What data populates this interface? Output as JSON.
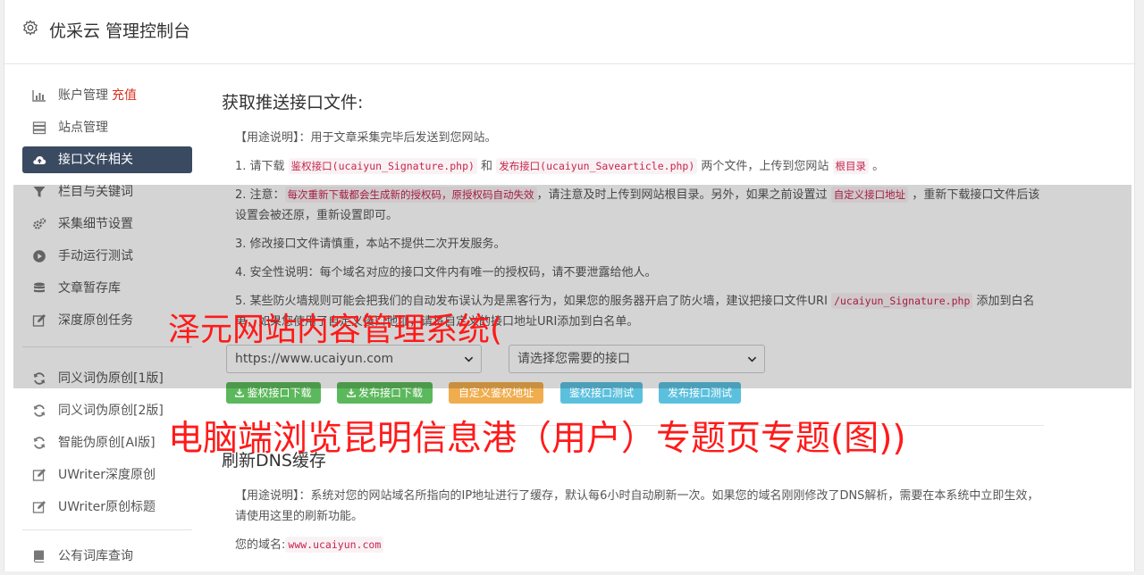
{
  "header": {
    "title": "优采云 管理控制台",
    "icon": "gear-icon"
  },
  "sidebar": {
    "items": [
      {
        "label": "账户管理",
        "extra": "充值",
        "icon": "bar-chart-icon"
      },
      {
        "label": "站点管理",
        "icon": "server-icon"
      },
      {
        "label": "接口文件相关",
        "icon": "cloud-upload-icon",
        "active": true
      },
      {
        "label": "栏目与关键词",
        "icon": "filter-icon"
      },
      {
        "label": "采集细节设置",
        "icon": "cogs-icon"
      },
      {
        "label": "手动运行测试",
        "icon": "play-circle-icon"
      },
      {
        "label": "文章暂存库",
        "icon": "database-icon"
      },
      {
        "label": "深度原创任务",
        "icon": "edit-icon"
      },
      {
        "label": "同义词伪原创[1版]",
        "icon": "refresh-icon"
      },
      {
        "label": "同义词伪原创[2版]",
        "icon": "refresh-icon"
      },
      {
        "label": "智能伪原创[AI版]",
        "icon": "refresh-icon"
      },
      {
        "label": "UWriter深度原创",
        "icon": "edit-icon"
      },
      {
        "label": "UWriter原创标题",
        "icon": "edit-icon"
      },
      {
        "label": "公有词库查询",
        "icon": "book-icon"
      }
    ]
  },
  "main": {
    "section1": {
      "title": "获取推送接口文件:",
      "usage": "【用途说明】：用于文章采集完毕后发送到您网站。",
      "p1": {
        "a": "1. 请下载 ",
        "c1": "鉴权接口(ucaiyun_Signature.php)",
        "b": " 和 ",
        "c2": "发布接口(ucaiyun_Savearticle.php)",
        "d": " 两个文件，上传到您网站 ",
        "c3": "根目录",
        "e": " 。"
      },
      "p2": {
        "a": "2. 注意：",
        "c1": "每次重新下载都会生成新的授权码，原授权码自动失效",
        "b": "，请注意及时上传到网站根目录。另外，如果之前设置过 ",
        "c2": "自定义接口地址",
        "d": " ，重新下载接口文件后该设置会被还原，重新设置即可。"
      },
      "p3": "3. 修改接口文件请慎重，本站不提供二次开发服务。",
      "p4": "4. 安全性说明：每个域名对应的接口文件内有唯一的授权码，请不要泄露给他人。",
      "p5": {
        "a": "5. 某些防火墙规则可能会把我们的自动发布误认为是黑客行为，如果您的服务器开启了防火墙，建议把接口文件URI ",
        "c1": "/ucaiyun_Signature.php",
        "b": " 添加到白名单，如果您使用了自定义接口地址，请将自定义的接口地址URI添加到白名单。"
      },
      "site_select": "https://www.ucaiyun.com",
      "iface_select": "请选择您需要的接口",
      "buttons": [
        {
          "label": "鉴权接口下载",
          "color": "#5cb85c",
          "icon": "download-icon"
        },
        {
          "label": "发布接口下载",
          "color": "#5cb85c",
          "icon": "download-icon"
        },
        {
          "label": "自定义鉴权地址",
          "color": "#f0ad4e"
        },
        {
          "label": "鉴权接口测试",
          "color": "#5bc0de"
        },
        {
          "label": "发布接口测试",
          "color": "#5bc0de"
        }
      ]
    },
    "section2": {
      "title": "刷新DNS缓存",
      "usage": "【用途说明】：系统对您的网站域名所指向的IP地址进行了缓存，默认每6小时自动刷新一次。如果您的域名刚刚修改了DNS解析，需要在本系统中立即生效，请使用这里的刷新功能。",
      "domain_label": "您的域名:",
      "domain_value": "www.ucaiyun.com"
    }
  },
  "watermark": {
    "line1": "泽元网站内容管理系统(",
    "line2": "电脑端浏览昆明信息港（用户）专题页专题(图))"
  }
}
